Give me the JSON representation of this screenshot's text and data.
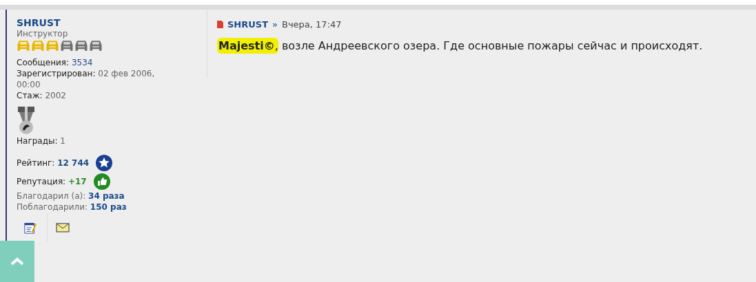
{
  "author": {
    "name": "SHRUST",
    "rank": "Инструктор",
    "stars": 3,
    "stats": [
      {
        "label": "Сообщения:",
        "value": "3534"
      },
      {
        "label": "Зарегистрирован:",
        "value": "02 фев 2006, 00:00"
      },
      {
        "label": "Стаж:",
        "value": "2002"
      }
    ],
    "awards": {
      "label": "Награды:",
      "value": "1"
    },
    "rating": {
      "label": "Рейтинг:",
      "value": "12 744"
    },
    "reputation": {
      "label": "Репутация:",
      "value": "+17"
    },
    "thanks": [
      {
        "label": "Благодарил (а):",
        "value": "34 раза"
      },
      {
        "label": "Поблагодарили:",
        "value": "150 раз"
      }
    ]
  },
  "post": {
    "author": "SHRUST",
    "separator": "»",
    "time": "Вчера, 17:47",
    "mention": "**Majesti©**,",
    "text": "возле Андреевского озера. Где основные пожары сейчас и происходят."
  }
}
